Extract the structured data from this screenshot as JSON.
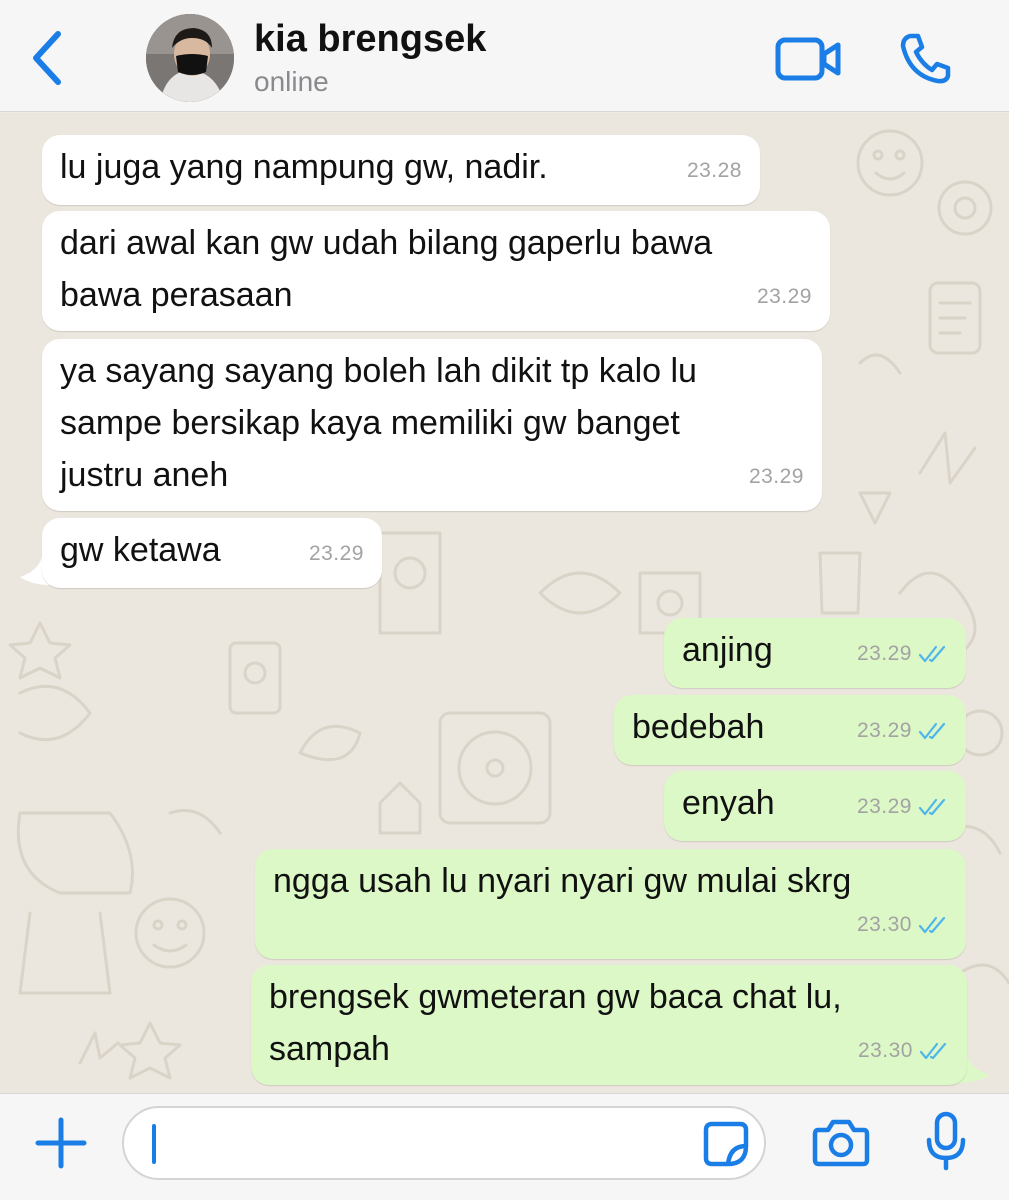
{
  "header": {
    "contact_name": "kia brengsek",
    "status": "online",
    "accent_color": "#1a7ee6"
  },
  "messages": [
    {
      "direction": "incoming",
      "text": "lu juga yang nampung gw, nadir.",
      "time": "23.28"
    },
    {
      "direction": "incoming",
      "text": "dari awal kan gw udah bilang gaperlu bawa\nbawa perasaan",
      "time": "23.29"
    },
    {
      "direction": "incoming",
      "text": "ya sayang sayang boleh lah dikit tp kalo lu\nsampe bersikap kaya memiliki gw banget\njustru aneh",
      "time": "23.29"
    },
    {
      "direction": "incoming",
      "text": "gw ketawa",
      "time": "23.29"
    },
    {
      "direction": "outgoing",
      "text": "anjing",
      "time": "23.29",
      "status": "read"
    },
    {
      "direction": "outgoing",
      "text": "bedebah",
      "time": "23.29",
      "status": "read"
    },
    {
      "direction": "outgoing",
      "text": "enyah",
      "time": "23.29",
      "status": "read"
    },
    {
      "direction": "outgoing",
      "text": "ngga usah lu nyari nyari gw mulai skrg",
      "time": "23.30",
      "status": "read"
    },
    {
      "direction": "outgoing",
      "text": "brengsek gwmeteran gw baca chat lu,\nsampah",
      "time": "23.30",
      "status": "read"
    }
  ],
  "composer": {
    "value": ""
  },
  "colors": {
    "incoming_bubble": "#ffffff",
    "outgoing_bubble": "#dcf8c6",
    "read_ticks": "#4fb6ec",
    "wallpaper": "#ece7de"
  },
  "icons": [
    "back-chevron-icon",
    "video-call-icon",
    "phone-icon",
    "plus-icon",
    "sticker-icon",
    "camera-icon",
    "microphone-icon",
    "double-check-icon"
  ]
}
